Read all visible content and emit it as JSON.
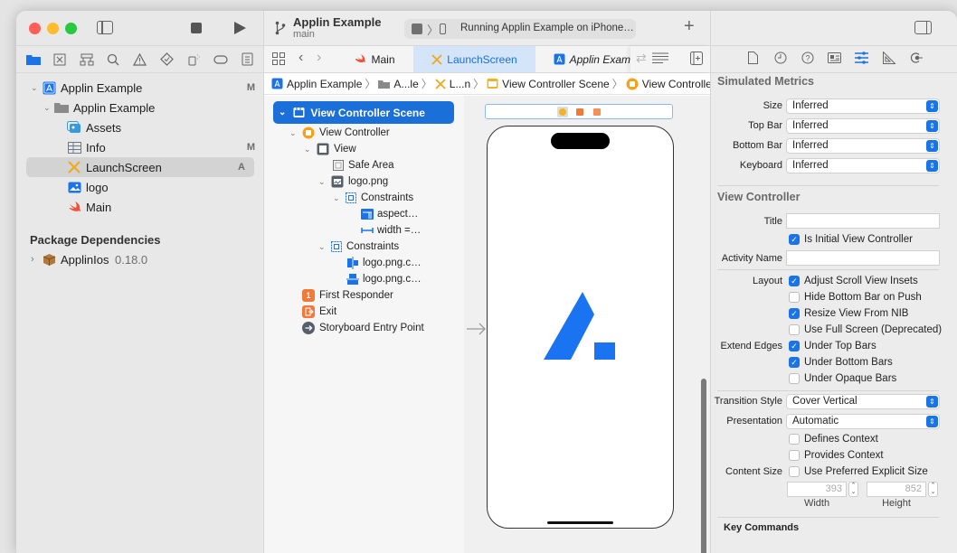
{
  "window": {
    "traffic_lights": {
      "close": "#ff5f57",
      "minimize": "#febc2e",
      "zoom": "#28c840"
    }
  },
  "toolbar": {
    "project_name": "Applin Example",
    "branch": "main",
    "status": "Running Applin Example on iPhone…",
    "add_label": "+"
  },
  "navigator": {
    "icons": [
      "folder-icon",
      "source-control-icon",
      "hierarchy-icon",
      "search-icon",
      "warning-icon",
      "test-icon",
      "debug-icon",
      "breakpoint-icon",
      "report-icon"
    ],
    "tree": [
      {
        "label": "Applin Example",
        "badge": "M",
        "level": 0,
        "icon": "app-project-icon",
        "expanded": true
      },
      {
        "label": "Applin Example",
        "badge": "",
        "level": 1,
        "icon": "folder-icon",
        "expanded": true
      },
      {
        "label": "Assets",
        "badge": "",
        "level": 2,
        "icon": "assets-icon"
      },
      {
        "label": "Info",
        "badge": "M",
        "level": 2,
        "icon": "plist-icon"
      },
      {
        "label": "LaunchScreen",
        "badge": "A",
        "level": 2,
        "icon": "storyboard-icon",
        "selected": true
      },
      {
        "label": "logo",
        "badge": "",
        "level": 2,
        "icon": "image-icon"
      },
      {
        "label": "Main",
        "badge": "",
        "level": 2,
        "icon": "swift-icon"
      }
    ],
    "package_header": "Package Dependencies",
    "packages": [
      {
        "name": "ApplinIos",
        "version": "0.18.0"
      }
    ]
  },
  "tabs": [
    {
      "label": "Main",
      "icon": "swift-icon",
      "active": false
    },
    {
      "label": "LaunchScreen",
      "icon": "storyboard-icon",
      "active": true
    },
    {
      "label": "Applin Exam",
      "icon": "app-project-icon",
      "active": false,
      "italic": true
    }
  ],
  "jumpbar": [
    "Applin Example",
    "A...le",
    "L...n",
    "View Controller Scene",
    "View Controller"
  ],
  "outline": [
    {
      "label": "View Controller Scene",
      "level": 0,
      "icon": "scene-icon",
      "selected": true,
      "expanded": true
    },
    {
      "label": "View Controller",
      "level": 1,
      "icon": "view-controller-icon",
      "expanded": true
    },
    {
      "label": "View",
      "level": 2,
      "icon": "view-icon",
      "expanded": true
    },
    {
      "label": "Safe Area",
      "level": 3,
      "icon": "safe-area-icon"
    },
    {
      "label": "logo.png",
      "level": 3,
      "icon": "image-view-icon",
      "expanded": true
    },
    {
      "label": "Constraints",
      "level": 4,
      "icon": "constraints-icon",
      "expanded": true
    },
    {
      "label": "aspect…",
      "level": 5,
      "icon": "aspect-constraint-icon"
    },
    {
      "label": "width =…",
      "level": 5,
      "icon": "width-constraint-icon"
    },
    {
      "label": "Constraints",
      "level": 3,
      "icon": "constraints-icon",
      "expanded": true
    },
    {
      "label": "logo.png.c…",
      "level": 4,
      "icon": "center-x-constraint-icon"
    },
    {
      "label": "logo.png.c…",
      "level": 4,
      "icon": "center-y-constraint-icon"
    },
    {
      "label": "First Responder",
      "level": 1,
      "icon": "first-responder-icon"
    },
    {
      "label": "Exit",
      "level": 1,
      "icon": "exit-icon"
    },
    {
      "label": "Storyboard Entry Point",
      "level": 1,
      "icon": "entry-point-icon"
    }
  ],
  "canvas": {
    "logo_color": "#1a73f0"
  },
  "inspector": {
    "icons": [
      "file-icon",
      "history-icon",
      "help-icon",
      "identity-icon",
      "attributes-icon",
      "size-icon",
      "connections-icon"
    ],
    "simulated_metrics": {
      "title": "Simulated Metrics",
      "fields": [
        {
          "label": "Size",
          "value": "Inferred"
        },
        {
          "label": "Top Bar",
          "value": "Inferred"
        },
        {
          "label": "Bottom Bar",
          "value": "Inferred"
        },
        {
          "label": "Keyboard",
          "value": "Inferred"
        }
      ]
    },
    "view_controller": {
      "title": "View Controller",
      "title_label": "Title",
      "title_value": "",
      "is_initial_label": "Is Initial View Controller",
      "is_initial": true,
      "activity_label": "Activity Name",
      "activity_value": "",
      "layout_label": "Layout",
      "layout": [
        {
          "label": "Adjust Scroll View Insets",
          "checked": true
        },
        {
          "label": "Hide Bottom Bar on Push",
          "checked": false
        },
        {
          "label": "Resize View From NIB",
          "checked": true
        },
        {
          "label": "Use Full Screen (Deprecated)",
          "checked": false
        }
      ],
      "extend_label": "Extend Edges",
      "extend": [
        {
          "label": "Under Top Bars",
          "checked": true
        },
        {
          "label": "Under Bottom Bars",
          "checked": true
        },
        {
          "label": "Under Opaque Bars",
          "checked": false
        }
      ],
      "transition_label": "Transition Style",
      "transition_value": "Cover Vertical",
      "presentation_label": "Presentation",
      "presentation_value": "Automatic",
      "context": [
        {
          "label": "Defines Context",
          "checked": false
        },
        {
          "label": "Provides Context",
          "checked": false
        }
      ],
      "content_size_label": "Content Size",
      "content_size_check": {
        "label": "Use Preferred Explicit Size",
        "checked": false
      },
      "width_value": "393",
      "height_value": "852",
      "width_label": "Width",
      "height_label": "Height"
    },
    "key_commands": "Key Commands"
  }
}
